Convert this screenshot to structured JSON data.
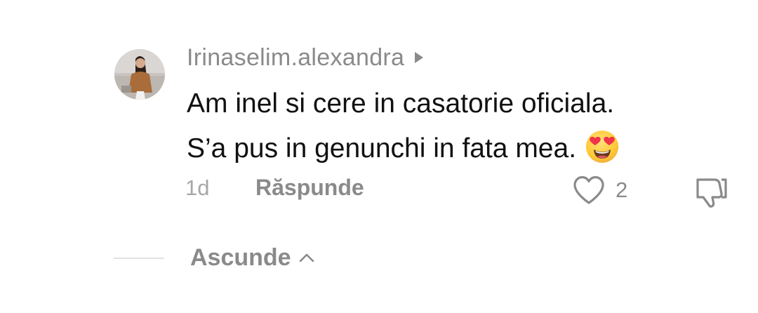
{
  "comment": {
    "avatar_icon": "user-avatar-photo",
    "username": "Irinaselim.alexandra",
    "username_caret_icon": "caret-right-icon",
    "text_lines": [
      "Am inel si cere in casatorie oficiala.",
      "S’a pus in genunchi in fata mea."
    ],
    "emoji_icon": "heart-eyes-emoji",
    "time": "1d",
    "reply_label": "Răspunde",
    "like_icon": "heart-outline-icon",
    "like_count": "2",
    "dislike_icon": "thumbs-down-outline-icon"
  },
  "thread": {
    "hide_label": "Ascunde",
    "hide_icon": "chevron-up-icon"
  },
  "colors": {
    "background": "#ffffff",
    "username": "#8a8a8a",
    "comment_text": "#111111",
    "meta_text": "#a7a7a7",
    "divider": "#e3e3e3"
  }
}
